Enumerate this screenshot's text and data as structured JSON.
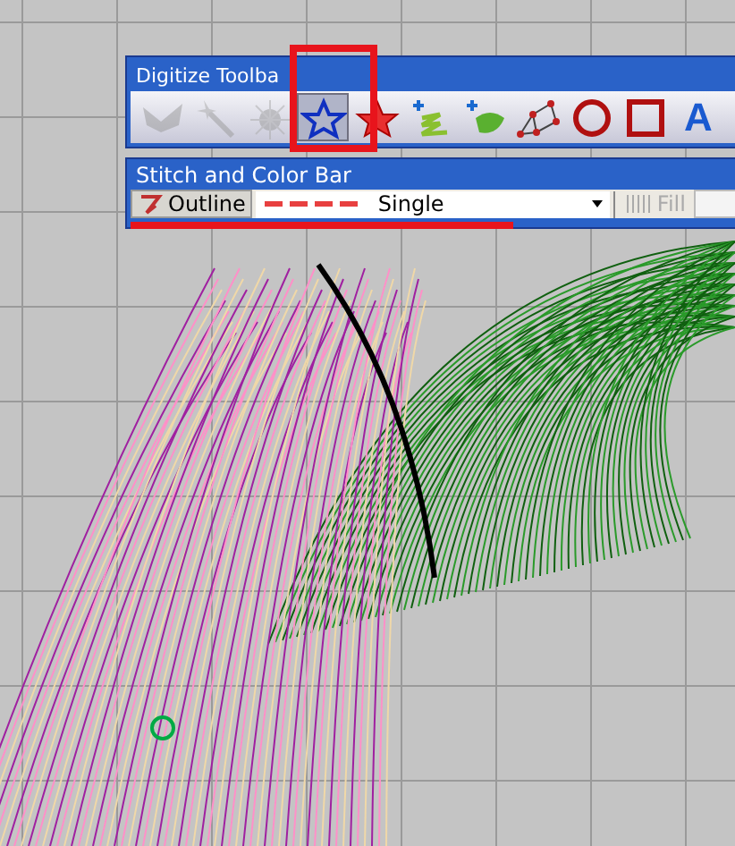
{
  "digitize_toolbar": {
    "title": "Digitize Toolba",
    "highlight_frame": true,
    "tools": [
      {
        "kind": "mask",
        "disabled": true,
        "selected": false
      },
      {
        "kind": "wand",
        "disabled": true,
        "selected": false
      },
      {
        "kind": "burst",
        "disabled": true,
        "selected": false
      },
      {
        "kind": "star-outline",
        "disabled": false,
        "selected": true
      },
      {
        "kind": "star-filled",
        "disabled": false,
        "selected": false
      },
      {
        "kind": "squiggle",
        "disabled": false,
        "selected": false
      },
      {
        "kind": "blob",
        "disabled": false,
        "selected": false
      },
      {
        "kind": "nodes",
        "disabled": false,
        "selected": false
      },
      {
        "kind": "circle",
        "disabled": false,
        "selected": false
      },
      {
        "kind": "square",
        "disabled": false,
        "selected": false
      },
      {
        "kind": "letter",
        "glyph": "A",
        "disabled": false,
        "selected": false
      }
    ]
  },
  "stitch_bar": {
    "title": "Stitch and Color Bar",
    "underlined": true,
    "outline_button": {
      "label": "Outline"
    },
    "line_style": {
      "value": "Single"
    },
    "fill_button": {
      "label": "Fill",
      "disabled": true
    }
  }
}
